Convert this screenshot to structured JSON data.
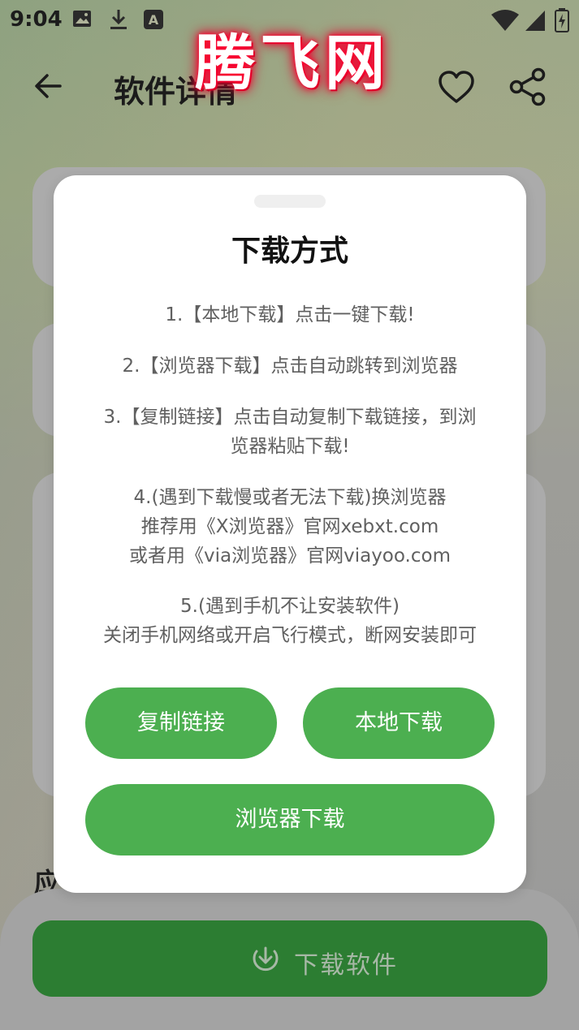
{
  "status_bar": {
    "time": "9:04",
    "icons": [
      "image-icon",
      "download-icon",
      "accessibility-a-icon",
      "wifi-icon",
      "cell-signal-icon",
      "battery-charging-icon"
    ]
  },
  "watermark": {
    "text": "腾飞网",
    "glow_color": "#ff0030"
  },
  "app_bar": {
    "title": "软件详情",
    "back_icon": "arrow-left-icon",
    "favorite_icon": "heart-outline-icon",
    "share_icon": "share-icon"
  },
  "background": {
    "section_peek_text": "应",
    "download_button_label": "下载软件",
    "download_button_icon": "download-circle-icon"
  },
  "dialog": {
    "title": "下载方式",
    "instructions": [
      {
        "lines": [
          "1.【本地下载】点击一键下载!"
        ]
      },
      {
        "lines": [
          "2.【浏览器下载】点击自动跳转到浏览器"
        ]
      },
      {
        "lines": [
          "3.【复制链接】点击自动复制下载链接，到浏",
          "览器粘贴下载!"
        ]
      },
      {
        "lines": [
          "4.(遇到下载慢或者无法下载)换浏览器",
          "推荐用《X浏览器》官网xebxt.com",
          "或者用《via浏览器》官网viayoo.com"
        ]
      },
      {
        "lines": [
          "5.(遇到手机不让安装软件)",
          "关闭手机网络或开启飞行模式，断网安装即可"
        ]
      }
    ],
    "buttons": {
      "copy_link": "复制链接",
      "local_download": "本地下载",
      "browser_download": "浏览器下载"
    }
  },
  "colors": {
    "accent_green": "#4caf50",
    "dark_green": "#2c7d32",
    "scrim_gray": "#9a9a9a"
  }
}
